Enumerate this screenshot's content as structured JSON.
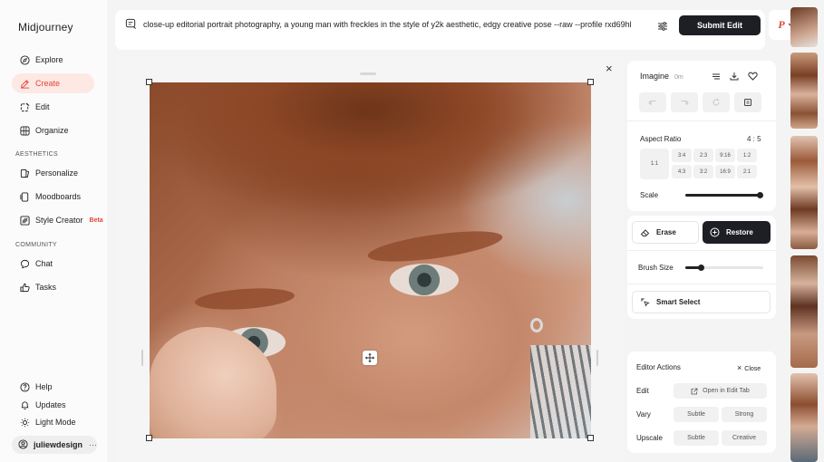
{
  "app": {
    "title": "Midjourney"
  },
  "sidebar": {
    "items": [
      {
        "label": "Explore",
        "icon": "compass-icon",
        "active": false
      },
      {
        "label": "Create",
        "icon": "brush-icon",
        "active": true
      },
      {
        "label": "Edit",
        "icon": "edit-icon",
        "active": false
      },
      {
        "label": "Organize",
        "icon": "grid-icon",
        "active": false
      }
    ],
    "aesthetics_label": "AESTHETICS",
    "aesthetics": [
      {
        "label": "Personalize",
        "icon": "personalize-icon"
      },
      {
        "label": "Moodboards",
        "icon": "moodboard-icon"
      },
      {
        "label": "Style Creator",
        "icon": "style-creator-icon",
        "badge": "Beta"
      }
    ],
    "community_label": "COMMUNITY",
    "community": [
      {
        "label": "Chat",
        "icon": "chat-icon"
      },
      {
        "label": "Tasks",
        "icon": "thumbs-up-icon"
      }
    ],
    "footer": [
      {
        "label": "Help",
        "icon": "help-icon"
      },
      {
        "label": "Updates",
        "icon": "bell-icon"
      },
      {
        "label": "Light Mode",
        "icon": "sun-icon"
      }
    ],
    "user": {
      "name": "juliewdesign",
      "more": "···"
    }
  },
  "prompt": {
    "text": "close-up editorial portrait photography, a young man with freckles in the style of y2k aesthetic, edgy creative pose --raw --profile rxd69hl",
    "submit_label": "Submit Edit",
    "profile_initial": "P"
  },
  "editor": {
    "close": "×"
  },
  "imagine": {
    "title": "Imagine",
    "time": "0m"
  },
  "aspect_ratio": {
    "label": "Aspect Ratio",
    "value": "4 : 5",
    "big": "1:1",
    "row1": [
      "3:4",
      "2:3",
      "9:16",
      "1:2"
    ],
    "row2": [
      "4:3",
      "3:2",
      "16:9",
      "2:1"
    ]
  },
  "scale": {
    "label": "Scale",
    "level": 1.0
  },
  "tools": {
    "erase": "Erase",
    "restore": "Restore"
  },
  "brush": {
    "label": "Brush Size",
    "level": 0.2
  },
  "smart_select": "Smart Select",
  "editor_actions": {
    "title": "Editor Actions",
    "close": "Close",
    "edit_label": "Edit",
    "open_in_edit": "Open in Edit Tab",
    "vary_label": "Vary",
    "vary_subtle": "Subtle",
    "vary_strong": "Strong",
    "upscale_label": "Upscale",
    "upscale_subtle": "Subtle",
    "upscale_creative": "Creative"
  },
  "colors": {
    "accent": "#e0463a",
    "dark": "#1e1f24",
    "active_bg": "#fde8e4"
  }
}
